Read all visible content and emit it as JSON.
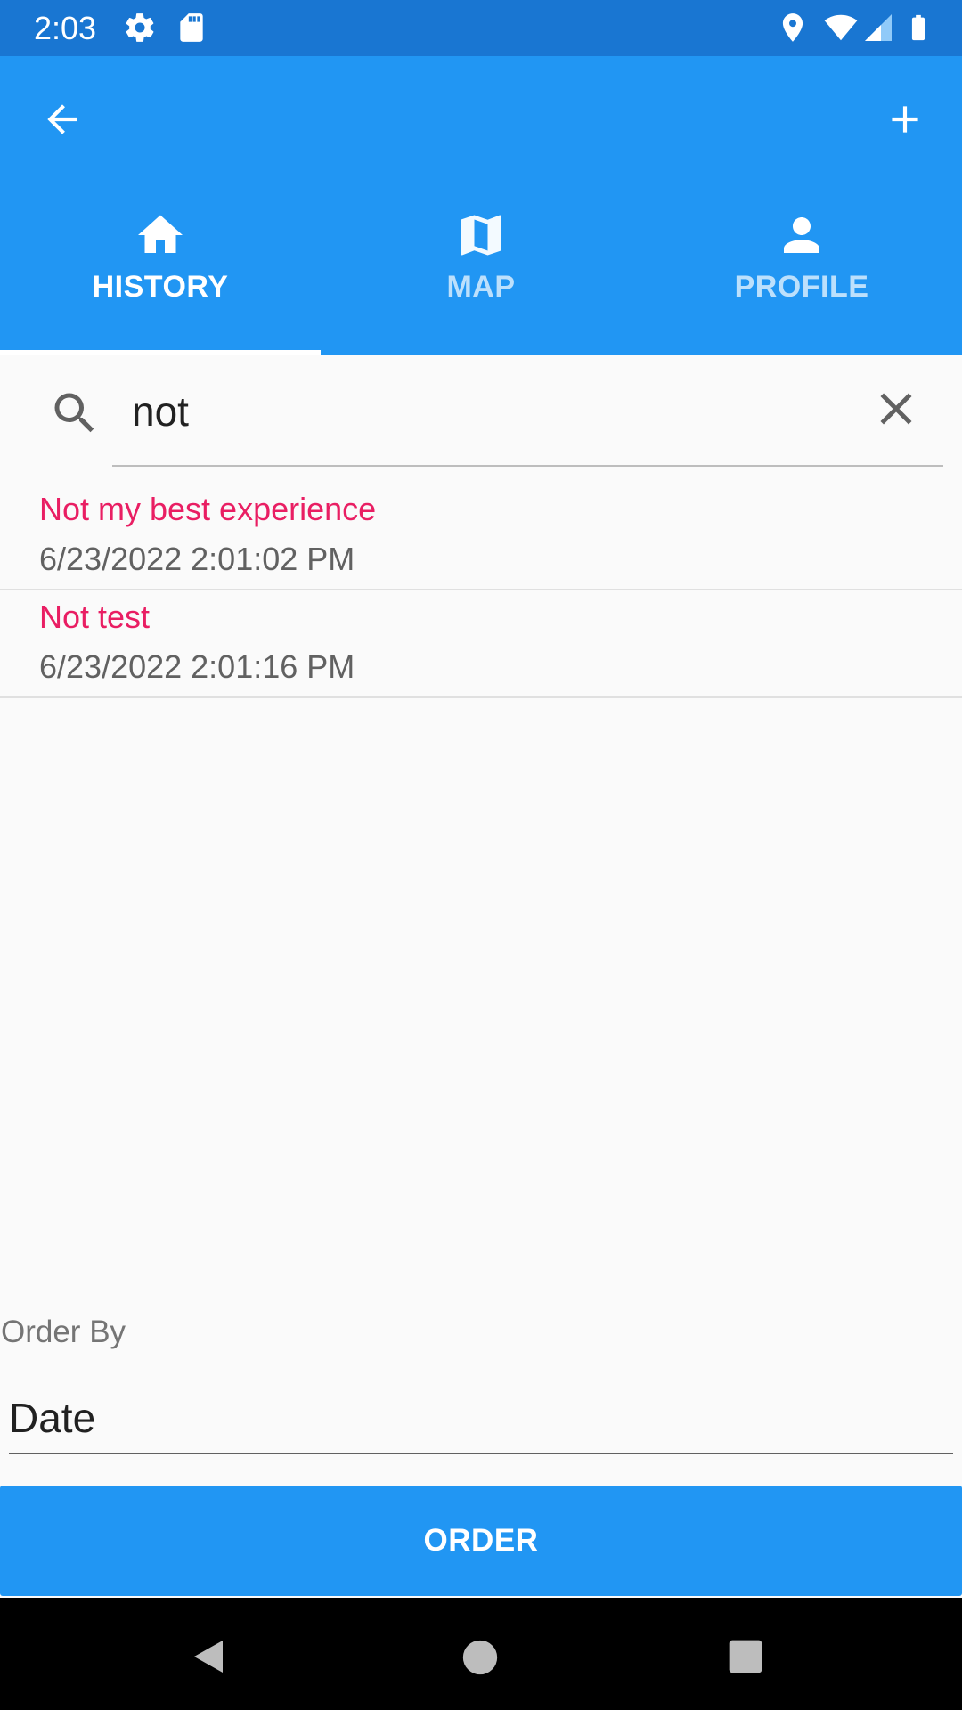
{
  "status_bar": {
    "time": "2:03",
    "icons": [
      "settings-icon",
      "sd-card-icon",
      "location-icon",
      "wifi-icon",
      "signal-icon",
      "battery-icon"
    ]
  },
  "app_bar": {
    "back_icon": "arrow-back-icon",
    "add_icon": "plus-icon",
    "background": "#2196F3"
  },
  "tabs": [
    {
      "label": "HISTORY",
      "icon": "home-icon",
      "selected": true
    },
    {
      "label": "MAP",
      "icon": "map-icon",
      "selected": false
    },
    {
      "label": "PROFILE",
      "icon": "person-icon",
      "selected": false
    }
  ],
  "search": {
    "value": "not",
    "search_icon": "search-icon",
    "clear_icon": "close-icon"
  },
  "results": [
    {
      "title": "Not my best experience",
      "date": "6/23/2022 2:01:02 PM"
    },
    {
      "title": "Not test",
      "date": "6/23/2022 2:01:16 PM"
    }
  ],
  "order": {
    "label": "Order By",
    "selected": "Date",
    "button_label": "ORDER"
  },
  "colors": {
    "accent": "#E91E63",
    "primary": "#2196F3",
    "primary_dark": "#1976D2"
  }
}
